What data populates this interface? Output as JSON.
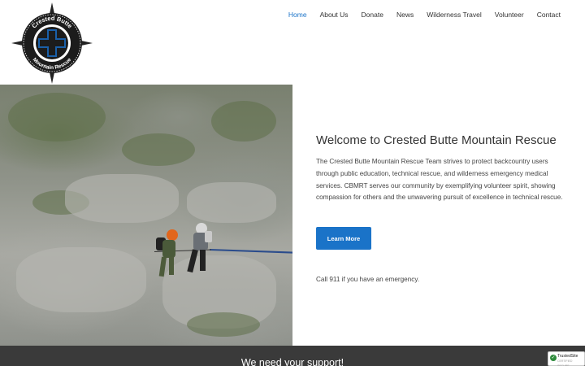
{
  "logo": {
    "text_top": "Crested Butte",
    "text_bottom": "Mountain Rescue",
    "icon": "compass-cross-logo"
  },
  "nav": {
    "items": [
      {
        "label": "Home",
        "active": true
      },
      {
        "label": "About Us",
        "active": false
      },
      {
        "label": "Donate",
        "active": false
      },
      {
        "label": "News",
        "active": false
      },
      {
        "label": "Wilderness Travel",
        "active": false
      },
      {
        "label": "Volunteer",
        "active": false
      },
      {
        "label": "Contact",
        "active": false
      }
    ]
  },
  "hero": {
    "title": "Welcome to Crested Butte Mountain Rescue",
    "description": "The Crested Butte Mountain Rescue Team strives to protect backcountry users through public education, technical rescue, and wilderness emergency medical services.  CBMRT serves our community by exemplifying volunteer spirit, showing compassion for others and the unwavering pursuit of excellence in technical rescue.",
    "button_label": "Learn More",
    "call_text": "Call 911 if you have an emergency."
  },
  "band": {
    "text": "We need your support!"
  },
  "badge": {
    "title": "TrustedSite",
    "subtitle": "CERTIFIED SECURE"
  },
  "colors": {
    "accent": "#1a73c8",
    "band": "#3a3a3a"
  }
}
